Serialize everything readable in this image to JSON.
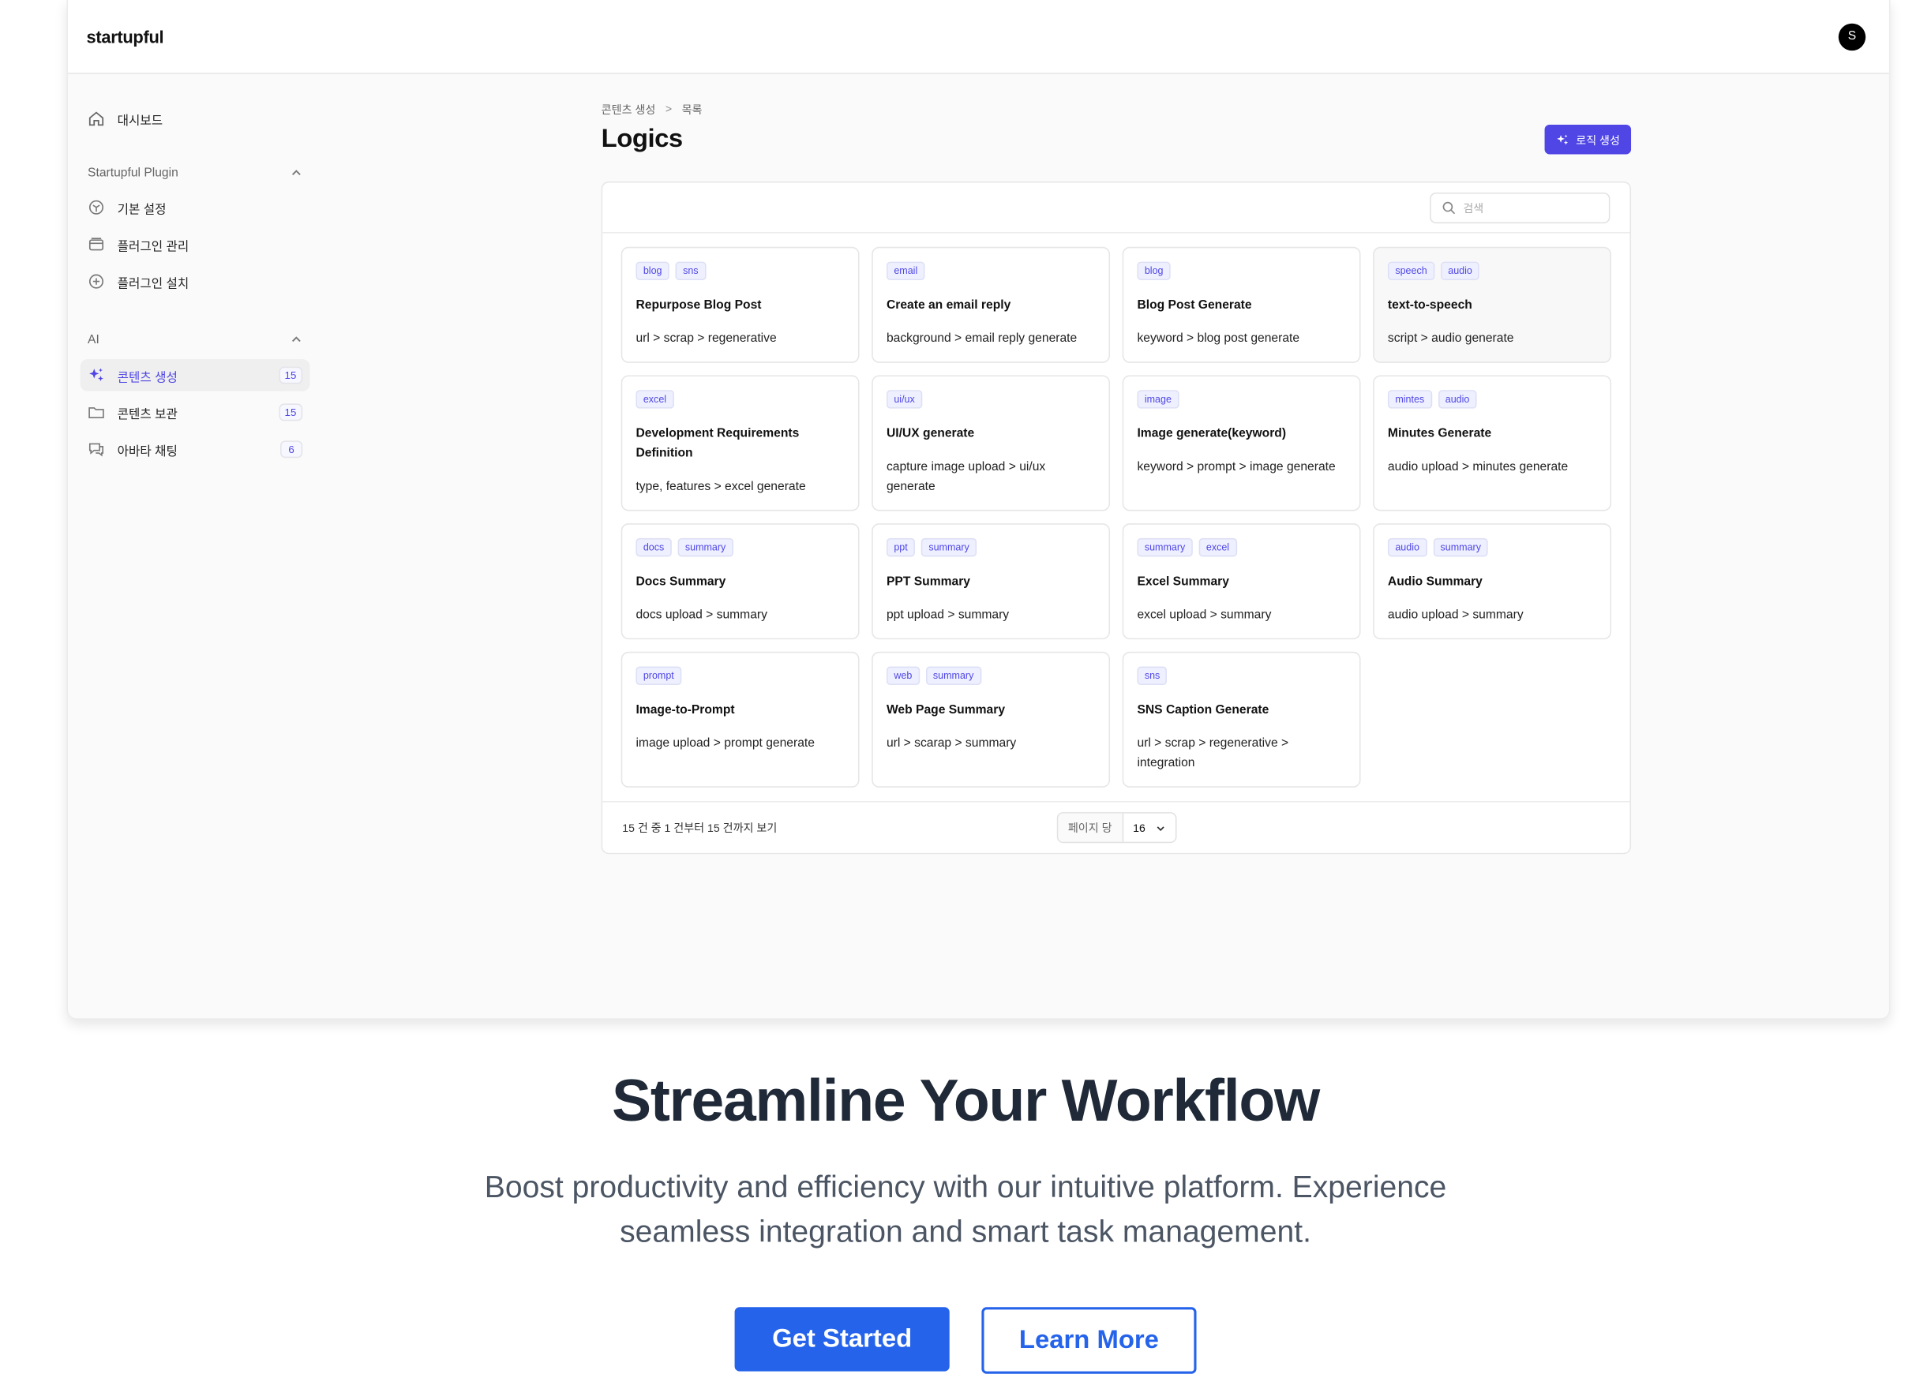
{
  "app": {
    "brand": "startupful",
    "avatar_initial": "S"
  },
  "sidebar": {
    "dashboard": {
      "label": "대시보드",
      "icon": "home-icon"
    },
    "sections": [
      {
        "title": "Startupful Plugin",
        "items": [
          {
            "label": "기본 설정",
            "icon": "settings-icon"
          },
          {
            "label": "플러그인 관리",
            "icon": "archive-icon"
          },
          {
            "label": "플러그인 설치",
            "icon": "plus-circle-icon"
          }
        ]
      },
      {
        "title": "AI",
        "items": [
          {
            "label": "콘텐츠 생성",
            "icon": "sparkles-icon",
            "count": "15",
            "active": true
          },
          {
            "label": "콘텐츠 보관",
            "icon": "folder-icon",
            "count": "15"
          },
          {
            "label": "아바타 채팅",
            "icon": "chat-icon",
            "count": "6"
          }
        ]
      }
    ]
  },
  "main": {
    "breadcrumb": [
      "콘텐츠 생성",
      "목록"
    ],
    "title": "Logics",
    "create_button": "로직 생성",
    "search_placeholder": "검색",
    "cards": [
      {
        "tags": [
          "blog",
          "sns"
        ],
        "title": "Repurpose Blog Post",
        "desc": "url > scrap > regenerative"
      },
      {
        "tags": [
          "email"
        ],
        "title": "Create an email reply",
        "desc": "background > email reply generate"
      },
      {
        "tags": [
          "blog"
        ],
        "title": "Blog Post Generate",
        "desc": "keyword > blog post generate"
      },
      {
        "tags": [
          "speech",
          "audio"
        ],
        "title": "text-to-speech",
        "desc": "script > audio generate",
        "highlighted": true
      },
      {
        "tags": [
          "excel"
        ],
        "title": "Development Requirements Definition",
        "desc": "type, features > excel generate"
      },
      {
        "tags": [
          "ui/ux"
        ],
        "title": "UI/UX generate",
        "desc": "capture image upload > ui/ux generate"
      },
      {
        "tags": [
          "image"
        ],
        "title": "Image generate(keyword)",
        "desc": "keyword > prompt > image generate"
      },
      {
        "tags": [
          "mintes",
          "audio"
        ],
        "title": "Minutes Generate",
        "desc": "audio upload > minutes generate"
      },
      {
        "tags": [
          "docs",
          "summary"
        ],
        "title": "Docs Summary",
        "desc": "docs upload > summary"
      },
      {
        "tags": [
          "ppt",
          "summary"
        ],
        "title": "PPT Summary",
        "desc": "ppt upload > summary"
      },
      {
        "tags": [
          "summary",
          "excel"
        ],
        "title": "Excel Summary",
        "desc": "excel upload > summary"
      },
      {
        "tags": [
          "audio",
          "summary"
        ],
        "title": "Audio Summary",
        "desc": "audio upload > summary"
      },
      {
        "tags": [
          "prompt"
        ],
        "title": "Image-to-Prompt",
        "desc": "image upload > prompt generate"
      },
      {
        "tags": [
          "web",
          "summary"
        ],
        "title": "Web Page Summary",
        "desc": "url > scarap > summary"
      },
      {
        "tags": [
          "sns"
        ],
        "title": "SNS Caption Generate",
        "desc": "url > scrap > regenerative > integration"
      }
    ],
    "footer": {
      "summary": "15 건 중 1 건부터 15 건까지 보기",
      "per_page_label": "페이지 당",
      "per_page_value": "16"
    }
  },
  "hero": {
    "headline": "Streamline Your Workflow",
    "subtext": "Boost productivity and efficiency with our intuitive platform. Experience seamless integration and smart task management.",
    "primary_cta": "Get Started",
    "secondary_cta": "Learn More"
  },
  "colors": {
    "accent": "#4f46e5",
    "cta_blue": "#2563eb",
    "headline": "#1f2937"
  }
}
